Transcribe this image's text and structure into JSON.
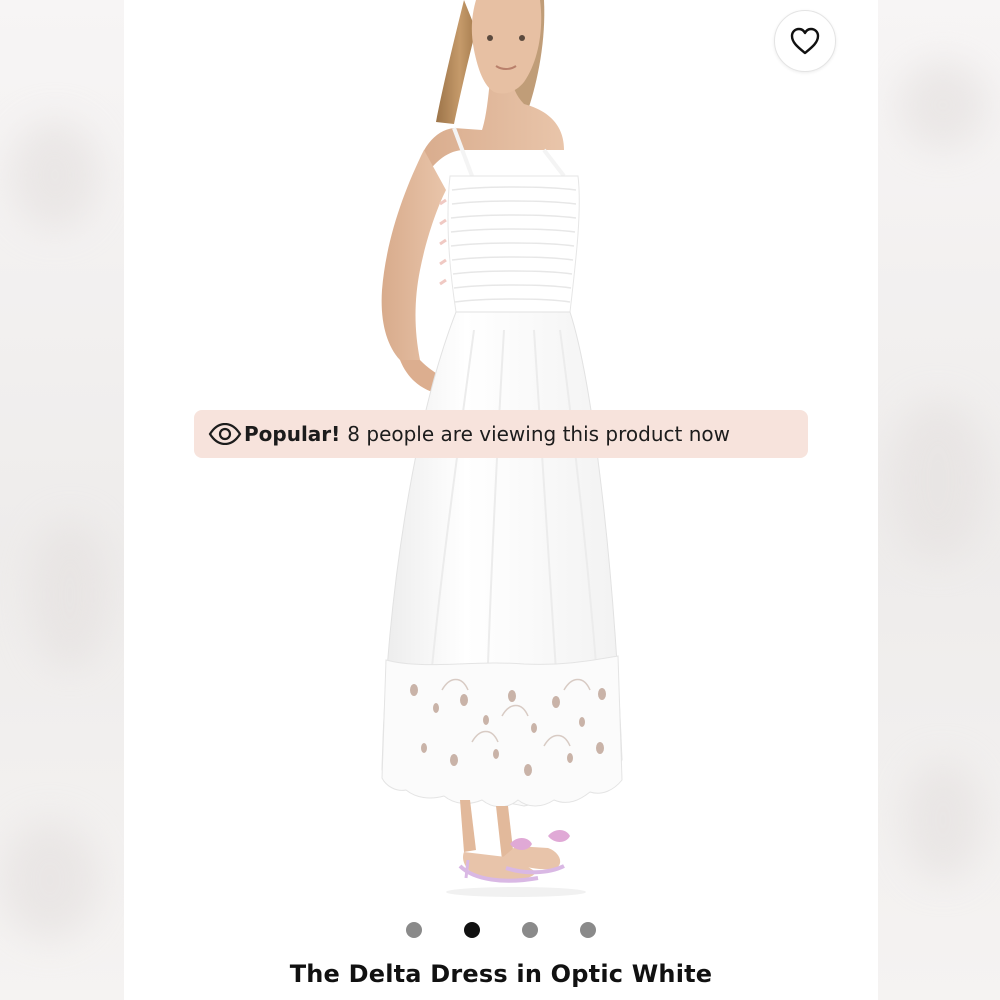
{
  "favorite": {
    "icon": "heart-icon"
  },
  "product_image": {
    "description_icon": "product-photo",
    "colors": {
      "dress": "#ffffff",
      "skin": "#e2b99b",
      "hair": "#b58a5e",
      "sandals": "#d9b8e4"
    }
  },
  "banner": {
    "icon": "eye-icon",
    "strong_text": "Popular!",
    "text": "8 people are viewing this product now",
    "background": "#f7e3dc"
  },
  "carousel": {
    "total": 4,
    "active_index": 1
  },
  "product": {
    "title": "The Delta Dress in Optic White"
  }
}
